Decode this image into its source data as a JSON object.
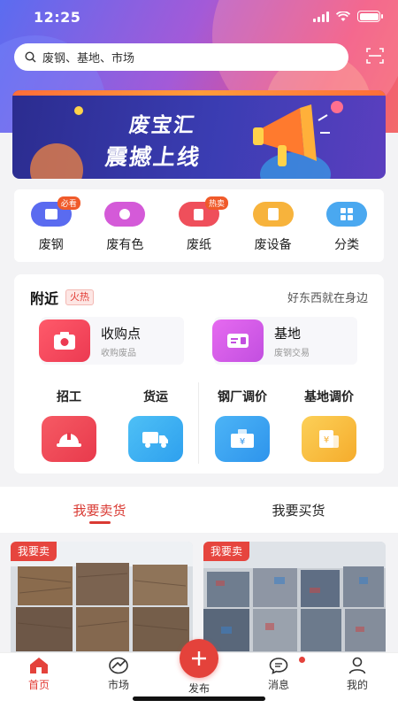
{
  "status_bar": {
    "time": "12:25"
  },
  "search": {
    "placeholder": "废钢、基地、市场"
  },
  "banner": {
    "line1": "废宝汇",
    "line2": "震撼上线"
  },
  "categories": [
    {
      "label": "废钢",
      "badge": "必看",
      "color": "#5a6bf0",
      "icon": "steel-bar-icon"
    },
    {
      "label": "废有色",
      "badge": "",
      "color": "#d45ad8",
      "icon": "copper-coil-icon"
    },
    {
      "label": "废纸",
      "badge": "热卖",
      "color": "#ef4f5b",
      "icon": "paper-icon"
    },
    {
      "label": "废设备",
      "badge": "",
      "color": "#f7b33c",
      "icon": "equipment-icon"
    },
    {
      "label": "分类",
      "badge": "",
      "color": "#4aa8f0",
      "icon": "grid-icon"
    }
  ],
  "nearby": {
    "title": "附近",
    "tag": "火热",
    "slogan": "好东西就在身边",
    "features": [
      {
        "name": "收购点",
        "sub": "收购废品",
        "color": "#f0465a",
        "icon": "camera-icon"
      },
      {
        "name": "基地",
        "sub": "废钢交易",
        "color": "#d35be0",
        "icon": "card-icon"
      }
    ],
    "services": [
      {
        "name": "招工",
        "color": "#ef4a57",
        "icon": "hardhat-icon"
      },
      {
        "name": "货运",
        "color": "#3eb0f0",
        "icon": "truck-icon"
      },
      {
        "name": "钢厂调价",
        "color": "#3aa5f0",
        "icon": "price-tag-icon"
      },
      {
        "name": "基地调价",
        "color": "#f8be3c",
        "icon": "price-doc-icon"
      }
    ]
  },
  "tabs": [
    {
      "label": "我要卖货",
      "active": true
    },
    {
      "label": "我要买货",
      "active": false
    }
  ],
  "products": [
    {
      "tag": "我要卖"
    },
    {
      "tag": "我要卖"
    }
  ],
  "bottom_nav": {
    "items": [
      {
        "label": "首页",
        "icon": "home-icon",
        "active": true
      },
      {
        "label": "市场",
        "icon": "market-icon",
        "active": false
      },
      {
        "label": "发布",
        "icon": "plus-icon",
        "active": false
      },
      {
        "label": "消息",
        "icon": "message-icon",
        "active": false
      },
      {
        "label": "我的",
        "icon": "profile-icon",
        "active": false
      }
    ]
  },
  "colors": {
    "accent": "#e4423b",
    "active_tab": "#d93a33"
  }
}
